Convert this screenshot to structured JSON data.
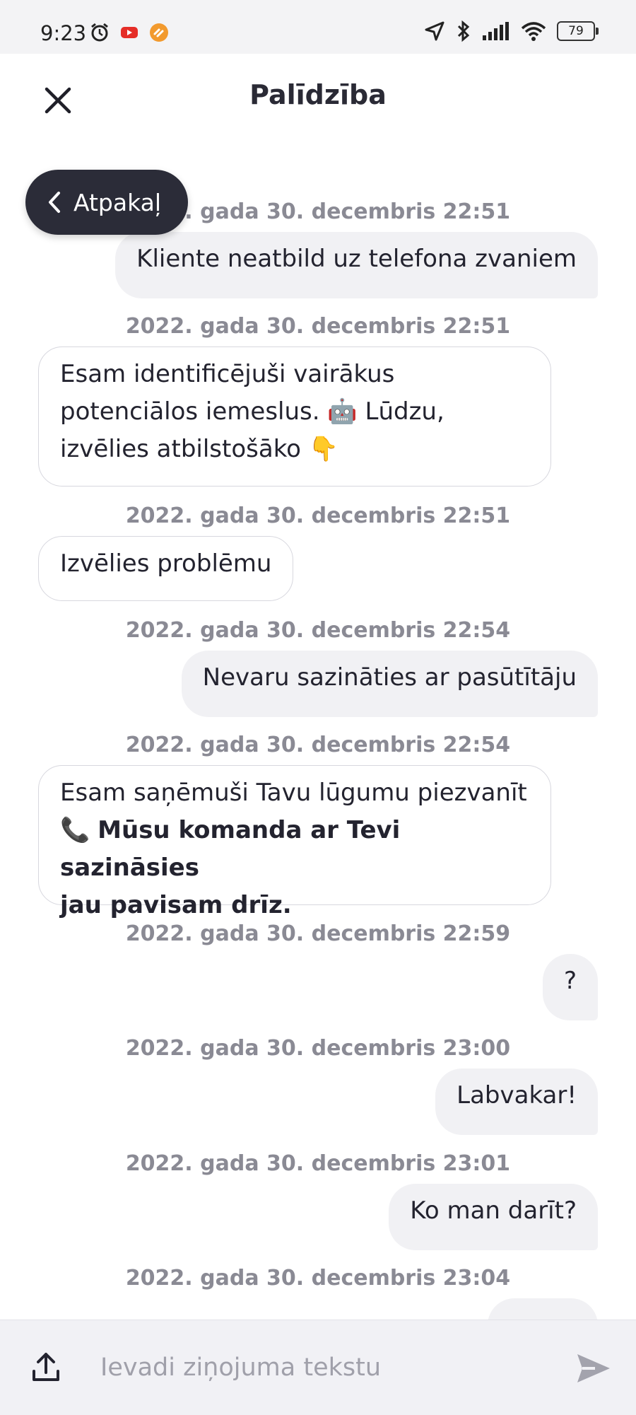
{
  "status_bar": {
    "time": "9:23",
    "battery": "79",
    "icons_left": [
      "alarm-icon",
      "youtube-icon",
      "app-notification-icon"
    ],
    "icons_right": [
      "location-icon",
      "bluetooth-icon",
      "signal-icon",
      "wifi-icon",
      "battery-icon"
    ]
  },
  "header": {
    "title": "Palīdzība",
    "close_icon": "close-icon"
  },
  "back_button": {
    "label": "Atpakaļ"
  },
  "messages": [
    {
      "timestamp": "2022. gada 30. decembris 22:51",
      "direction": "out",
      "text": "Kliente neatbild uz telefona zvaniem"
    },
    {
      "timestamp": "2022. gada 30. decembris 22:51",
      "direction": "in",
      "line1": "Esam identificējuši vairākus",
      "line2": "potenciālos iemeslus. 🤖 Lūdzu,",
      "line3": "izvēlies atbilstošāko 👇"
    },
    {
      "timestamp": "2022. gada 30. decembris 22:51",
      "direction": "in",
      "text": "Izvēlies problēmu"
    },
    {
      "timestamp": "2022. gada 30. decembris 22:54",
      "direction": "out",
      "text": "Nevaru sazināties ar pasūtītāju"
    },
    {
      "timestamp": "2022. gada 30. decembris 22:54",
      "direction": "in",
      "line1": "Esam saņēmuši Tavu lūgumu piezvanīt",
      "line2_icon": "📞",
      "line2_bold": "Mūsu komanda ar Tevi sazināsies",
      "line3_bold": "jau pavisam drīz."
    },
    {
      "timestamp": "2022. gada 30. decembris 22:59",
      "direction": "out",
      "text": "?"
    },
    {
      "timestamp": "2022. gada 30. decembris 23:00",
      "direction": "out",
      "text": "Labvakar!"
    },
    {
      "timestamp": "2022. gada 30. decembris 23:01",
      "direction": "out",
      "text": "Ko man darīt?"
    },
    {
      "timestamp": "2022. gada 30. decembris 23:04",
      "direction": "out",
      "text": ""
    }
  ],
  "composer": {
    "placeholder": "Ievadi ziņojuma tekstu",
    "value": ""
  },
  "colors": {
    "background": "#ffffff",
    "status_bar_bg": "#f3f3f5",
    "outgoing_bubble": "#f1f1f4",
    "incoming_border": "#d7d7de",
    "timestamp_text": "#8a8a94",
    "back_pill_bg": "#2b2c38",
    "composer_bg": "#f1f1f5",
    "send_icon": "#a3a3ad"
  }
}
